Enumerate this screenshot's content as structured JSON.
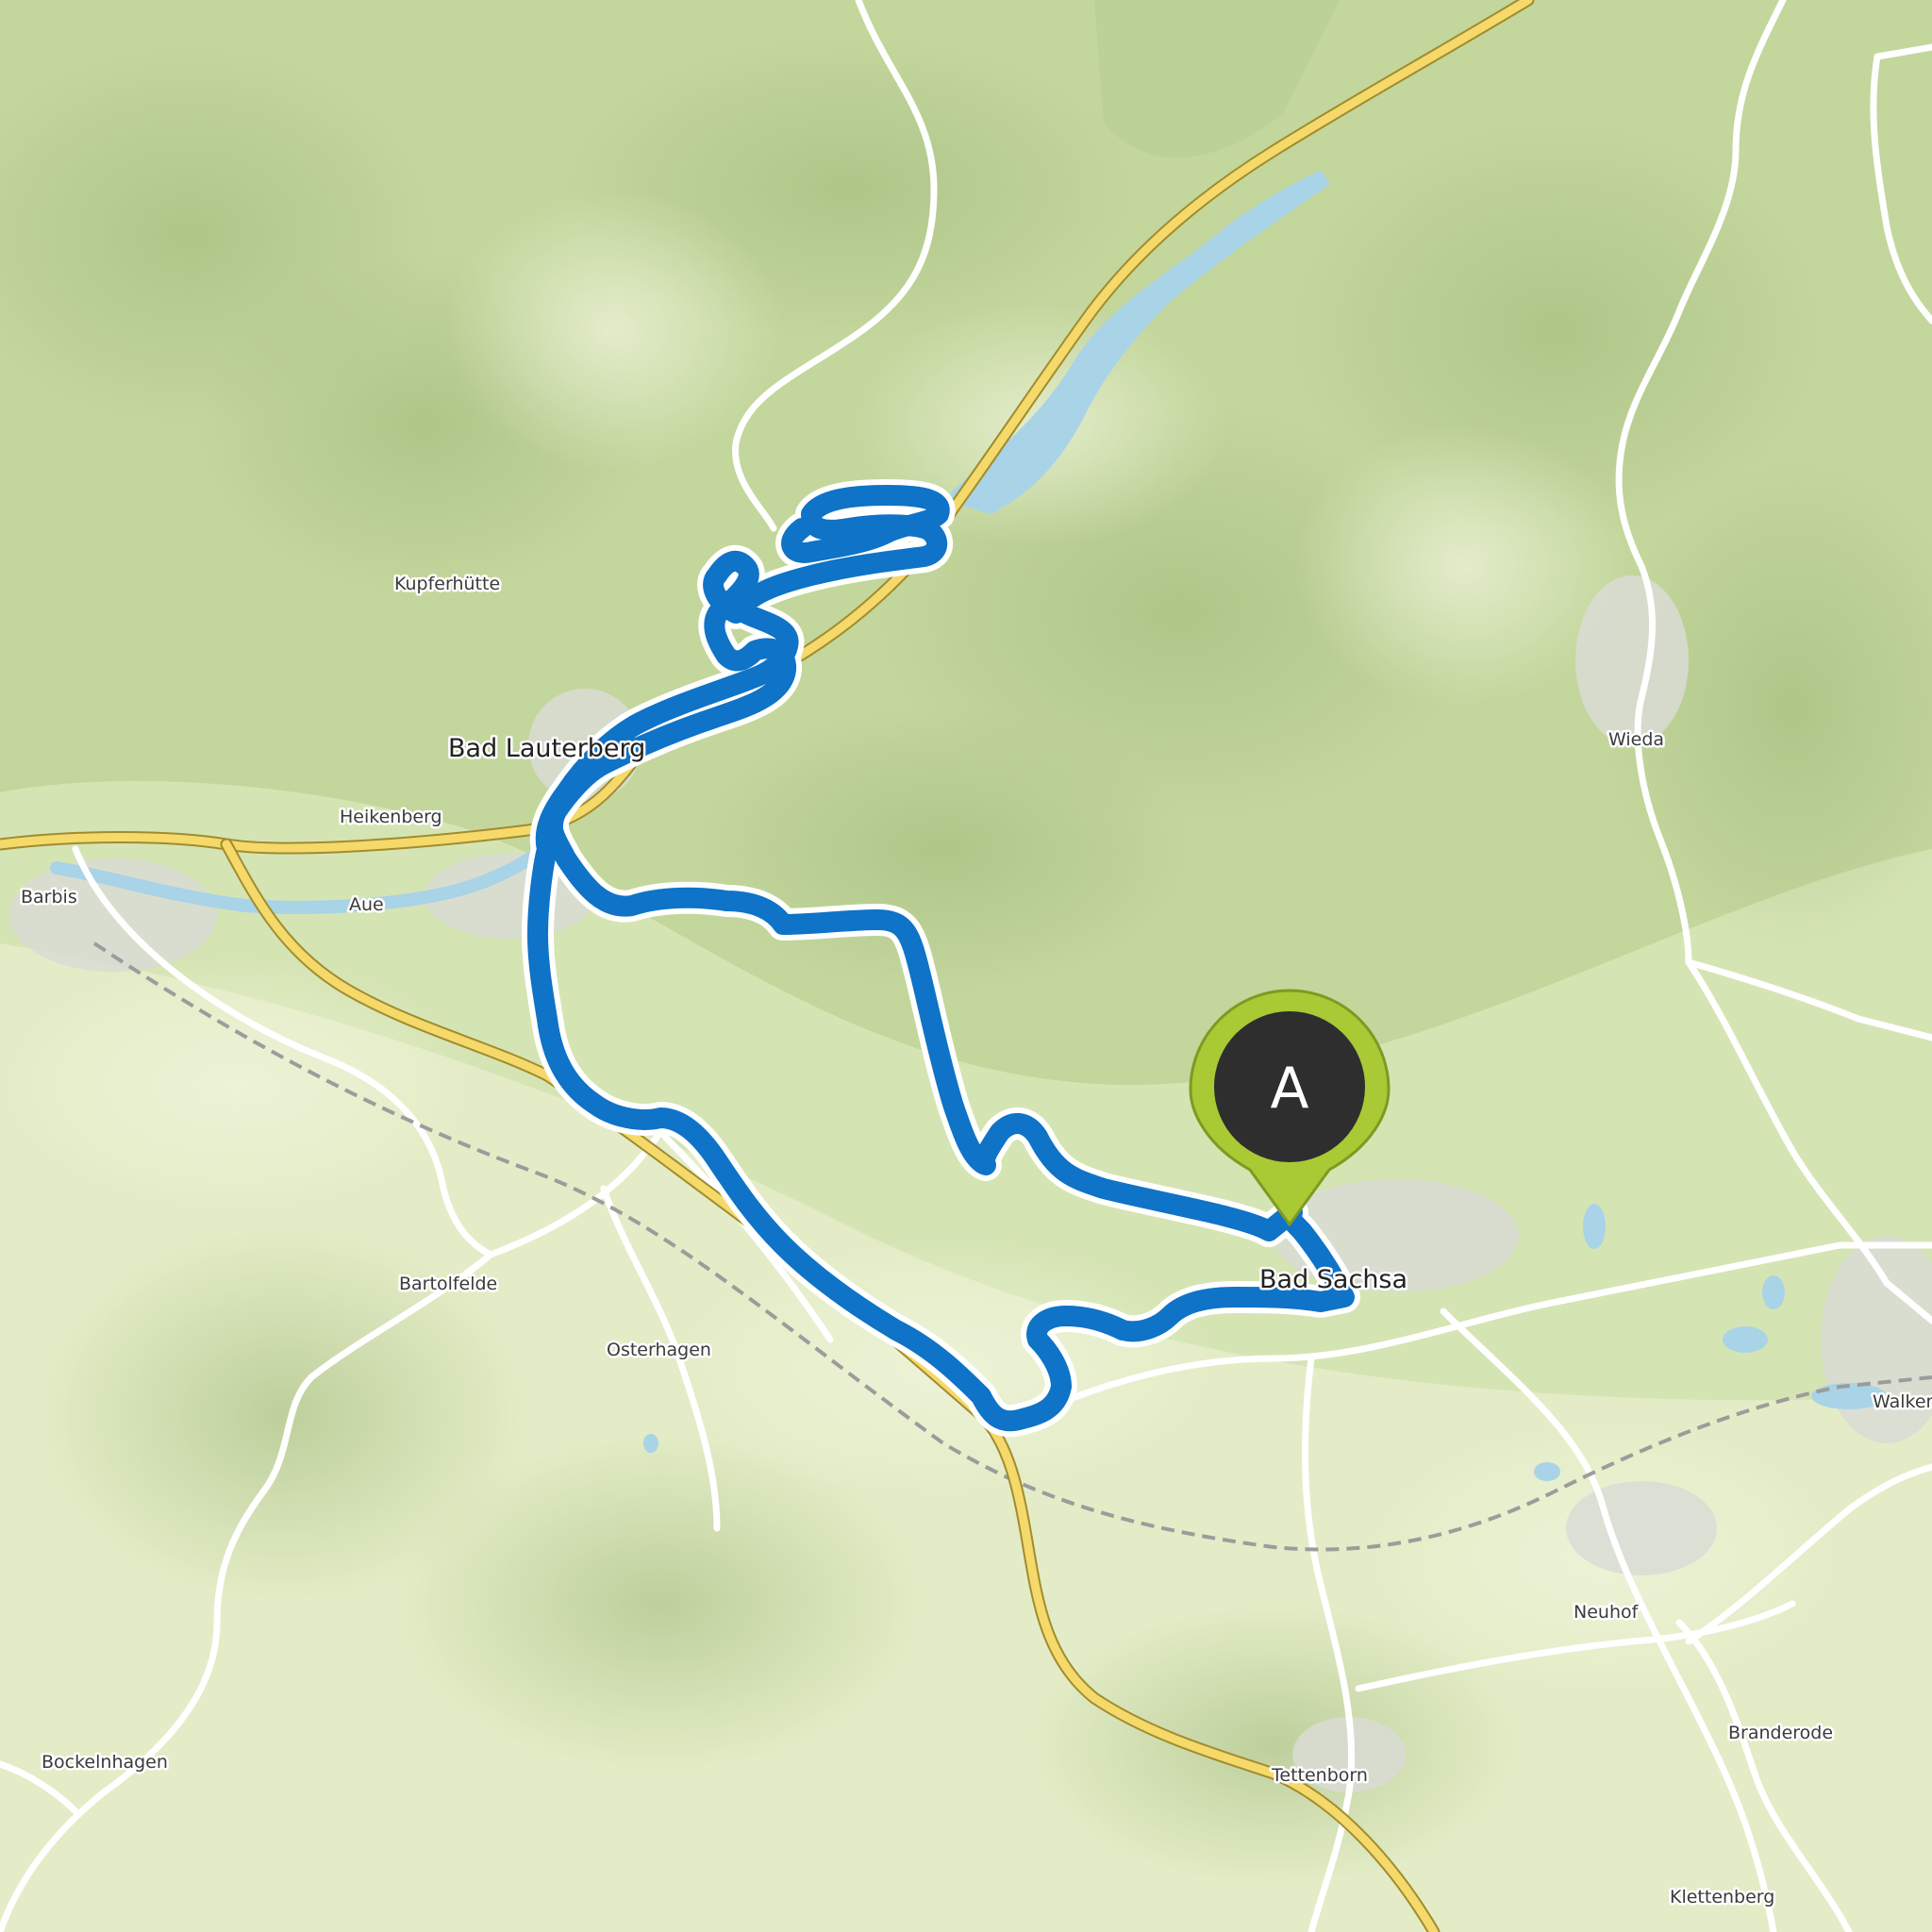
{
  "places": {
    "kupferhuette": "Kupferhütte",
    "bad_lauterberg": "Bad Lauterberg",
    "heikenberg": "Heikenberg",
    "barbis": "Barbis",
    "aue": "Aue",
    "wieda": "Wieda",
    "bad_sachsa": "Bad Sachsa",
    "bartolfelde": "Bartolfelde",
    "osterhagen": "Osterhagen",
    "neuhof": "Neuhof",
    "branderode": "Branderode",
    "bockelnhagen": "Bockelnhagen",
    "tettenborn": "Tettenborn",
    "klettenberg": "Klettenberg",
    "walkenried": "Walkenried"
  },
  "marker": {
    "letter": "A"
  },
  "colors": {
    "route": "#0f73c7",
    "route_casing": "#ffffff",
    "water": "#a9d3e6",
    "main_road": "#f5d96b",
    "minor_road": "#ffffff",
    "terrain": "#d8e6b8",
    "marker_pin": "#a9c935",
    "marker_head": "#2e2e2e"
  },
  "icons": {
    "marker": "start-marker-pin-icon"
  }
}
